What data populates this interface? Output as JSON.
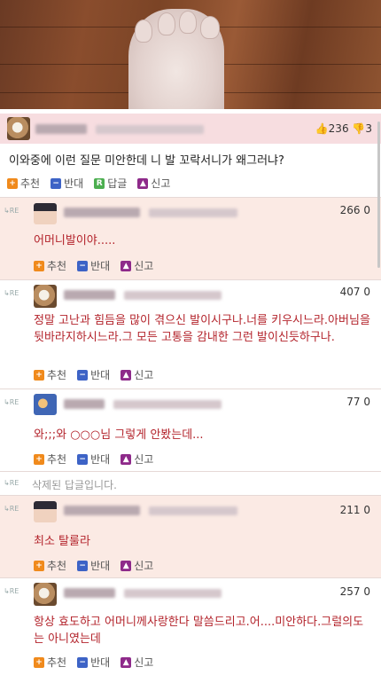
{
  "post": {
    "vote_up": "236",
    "vote_down": "3",
    "title": "이와중에 이런 질문 미안한데 니 발 꼬락서니가 왜그러냐?",
    "actions": {
      "recommend": "추천",
      "oppose": "반대",
      "reply": "답글",
      "report": "신고"
    }
  },
  "comments": [
    {
      "count": "266 0",
      "text": "어머니발이야....."
    },
    {
      "count": "407 0",
      "text": "정말 고난과 힘듬을 많이 겪으신 발이시구나.너를 키우시느라.아버님을 뒷바라지하시느라.그 모든 고통을 감내한 그런 발이신듯하구나."
    },
    {
      "count": "77 0",
      "text": "와;;;와 ○○○님 그렇게 안봤는데..."
    },
    {
      "deleted": "삭제된 답글입니다."
    },
    {
      "count": "211 0",
      "text": "최소 탈룰라"
    },
    {
      "count": "257 0",
      "text": "항상 효도하고 어머니께사랑한다 말씀드리고.어....미안하다.그럴의도는 아니였는데"
    }
  ],
  "comment_actions": {
    "recommend": "추천",
    "oppose": "반대",
    "report": "신고"
  },
  "re_label": "↳RE",
  "icons": {
    "recommend": "plus-icon",
    "oppose": "minus-icon",
    "reply": "reply-icon",
    "report": "report-icon"
  }
}
